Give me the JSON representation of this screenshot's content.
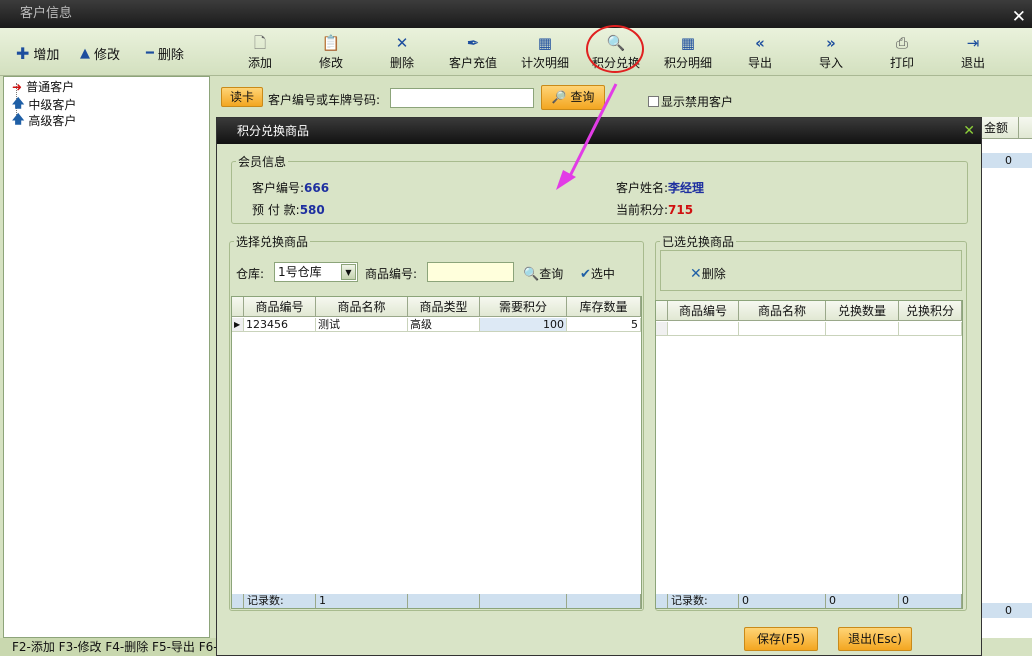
{
  "window": {
    "title": "客户信息"
  },
  "left_toolbar": [
    {
      "icon": "plus-icon",
      "label": "增加"
    },
    {
      "icon": "triangle-up-icon",
      "label": "修改"
    },
    {
      "icon": "minus-icon",
      "label": "删除"
    }
  ],
  "toolbar": [
    {
      "icon": "document-icon",
      "label": "添加"
    },
    {
      "icon": "edit-document-icon",
      "label": "修改"
    },
    {
      "icon": "x-icon",
      "label": "删除"
    },
    {
      "icon": "pen-icon",
      "label": "客户充值"
    },
    {
      "icon": "calendar-icon",
      "label": "计次明细"
    },
    {
      "icon": "magnifier-icon",
      "label": "积分兑换"
    },
    {
      "icon": "calendar-icon",
      "label": "积分明细"
    },
    {
      "icon": "double-left-icon",
      "label": "导出"
    },
    {
      "icon": "double-right-icon",
      "label": "导入"
    },
    {
      "icon": "printer-icon",
      "label": "打印"
    },
    {
      "icon": "exit-icon",
      "label": "退出"
    }
  ],
  "tree": [
    "普通客户",
    "中级客户",
    "高级客户"
  ],
  "search": {
    "read_card": "读卡",
    "label": "客户编号或车牌号码:",
    "value": "",
    "query": "查询",
    "show_disabled": "显示禁用客户"
  },
  "background_table": {
    "header_right": "金额",
    "cell_0": "0",
    "cell_1": "0"
  },
  "status_bar": "F2-添加 F3-修改 F4-删除 F5-导出 F6-",
  "dialog": {
    "title": "积分兑换商品",
    "member": {
      "legend": "会员信息",
      "id_label": "客户编号:",
      "id": "666",
      "prepay_label": "预 付 款:",
      "prepay": "580",
      "name_label": "客户姓名:",
      "name": "李经理",
      "points_label": "当前积分:",
      "points": "715"
    },
    "select": {
      "legend": "选择兑换商品",
      "warehouse_label": "仓库:",
      "warehouse": "1号仓库",
      "code_label": "商品编号:",
      "code_value": "",
      "query": "查询",
      "pick": "选中",
      "columns": [
        "商品编号",
        "商品名称",
        "商品类型",
        "需要积分",
        "库存数量"
      ],
      "rows": [
        [
          "123456",
          "测试",
          "高级",
          "100",
          "5"
        ]
      ],
      "footer_label": "记录数:",
      "footer_count": "1"
    },
    "chosen": {
      "legend": "已选兑换商品",
      "delete": "删除",
      "columns": [
        "商品编号",
        "商品名称",
        "兑换数量",
        "兑换积分"
      ],
      "footer_label": "记录数:",
      "footer_vals": [
        "0",
        "0",
        "0"
      ]
    },
    "save": "保存(F5)",
    "exit": "退出(Esc)"
  }
}
